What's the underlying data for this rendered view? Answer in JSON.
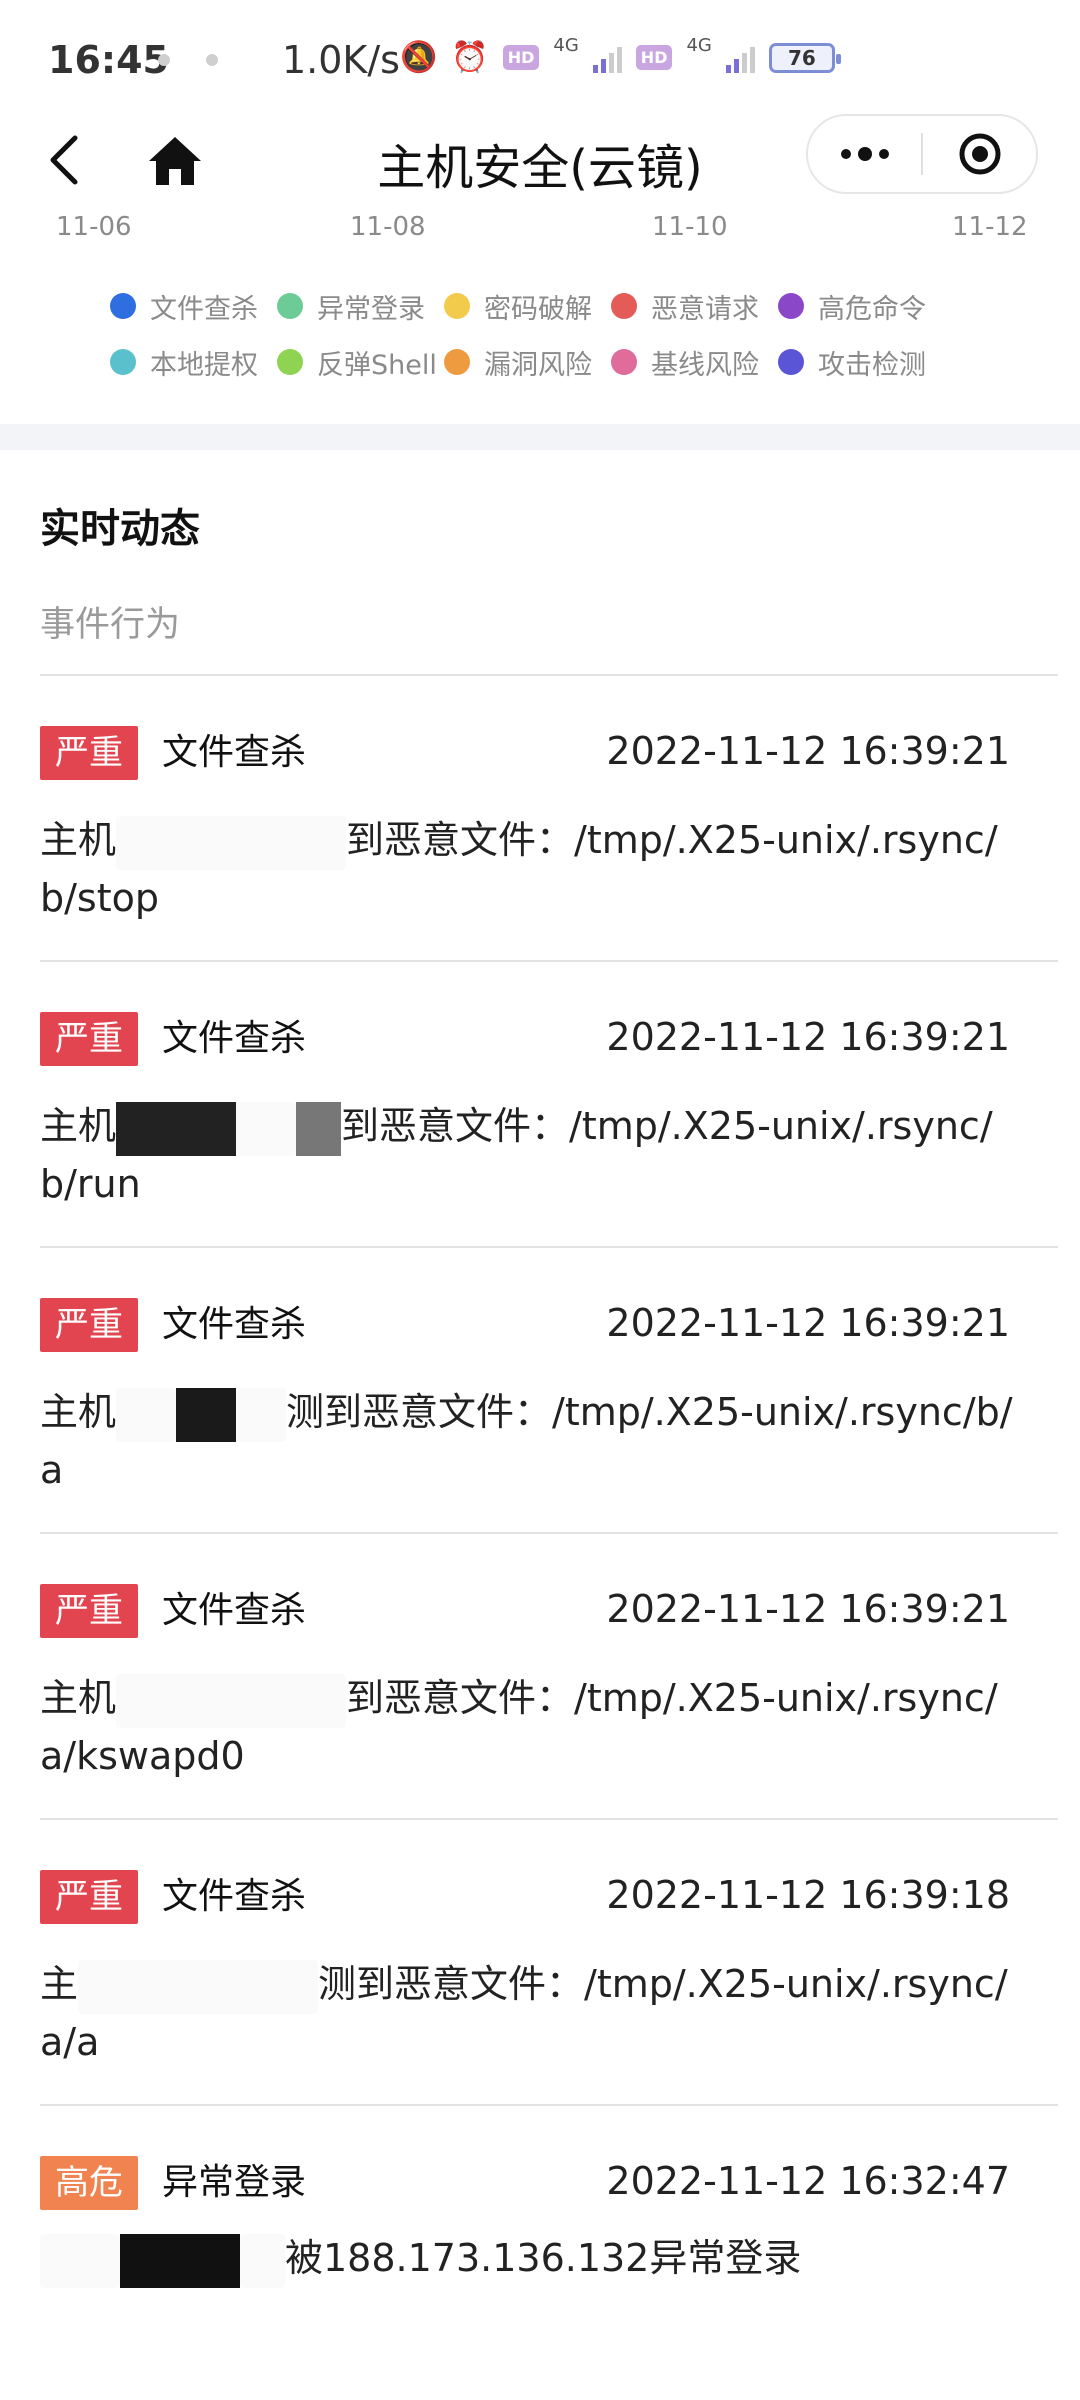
{
  "status_bar": {
    "time": "16:45",
    "speed": "1.0K/s",
    "net1": "4G",
    "net2": "4G",
    "hd": "HD",
    "battery": "76"
  },
  "nav": {
    "title": "主机安全(云镜)"
  },
  "chart_data": {
    "type": "line",
    "x_ticks": [
      "11-06",
      "11-08",
      "11-10",
      "11-12"
    ],
    "legend": [
      {
        "name": "文件查杀",
        "color": "#2f6ee0"
      },
      {
        "name": "异常登录",
        "color": "#6dcc96"
      },
      {
        "name": "密码破解",
        "color": "#f2cb4c"
      },
      {
        "name": "恶意请求",
        "color": "#e45b58"
      },
      {
        "name": "高危命令",
        "color": "#8a48c8"
      },
      {
        "name": "本地提权",
        "color": "#5ac1cc"
      },
      {
        "name": "反弹Shell",
        "color": "#8fd352"
      },
      {
        "name": "漏洞风险",
        "color": "#ee9a3f"
      },
      {
        "name": "基线风险",
        "color": "#df6c9a"
      },
      {
        "name": "攻击检测",
        "color": "#5a55d6"
      }
    ]
  },
  "section": {
    "title": "实时动态",
    "subtitle": "事件行为"
  },
  "events": [
    {
      "level": "严重",
      "level_color": "#e2454f",
      "type": "文件查杀",
      "time": "2022-11-12 16:39:21",
      "desc_start": "主机",
      "desc_end": "到恶意文件：/tmp/.X25-unix/.rsync/b/stop"
    },
    {
      "level": "严重",
      "level_color": "#e2454f",
      "type": "文件查杀",
      "time": "2022-11-12 16:39:21",
      "desc_start": "主机",
      "desc_end": "到恶意文件：/tmp/.X25-unix/.rsync/b/run"
    },
    {
      "level": "严重",
      "level_color": "#e2454f",
      "type": "文件查杀",
      "time": "2022-11-12 16:39:21",
      "desc_start": "主机",
      "desc_end": "测到恶意文件：/tmp/.X25-unix/.rsync/b/a"
    },
    {
      "level": "严重",
      "level_color": "#e2454f",
      "type": "文件查杀",
      "time": "2022-11-12 16:39:21",
      "desc_start": "主机",
      "desc_end": "到恶意文件：/tmp/.X25-unix/.rsync/a/kswapd0"
    },
    {
      "level": "严重",
      "level_color": "#e2454f",
      "type": "文件查杀",
      "time": "2022-11-12 16:39:18",
      "desc_start": "主",
      "desc_end": "测到恶意文件：/tmp/.X25-unix/.rsync/a/a"
    },
    {
      "level": "高危",
      "level_color": "#f0834f",
      "type": "异常登录",
      "time": "2022-11-12 16:32:47",
      "desc_start": "",
      "desc_end": "被188.173.136.132异常登录"
    }
  ]
}
